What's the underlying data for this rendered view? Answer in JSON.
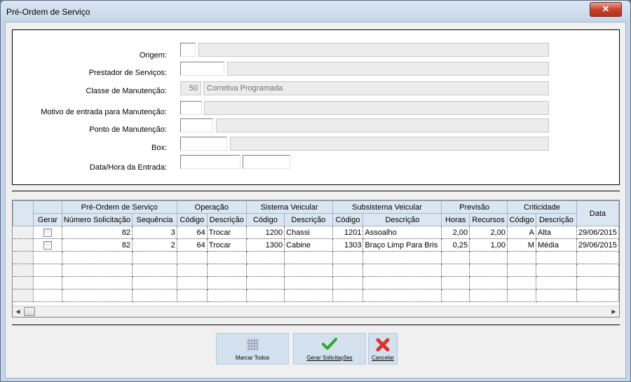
{
  "window": {
    "title": "Pré-Ordem de Serviço",
    "close_glyph": "✕"
  },
  "form": {
    "origem": {
      "label": "Origem:",
      "code": "",
      "desc": ""
    },
    "prestador": {
      "label": "Prestador de Serviços:",
      "code": "",
      "desc": ""
    },
    "classe": {
      "label": "Classe de Manutenção:",
      "code": "50",
      "desc": "Corretiva Programada"
    },
    "motivo": {
      "label": "Motivo de entrada para Manutenção:",
      "code": "",
      "desc": ""
    },
    "ponto": {
      "label": "Ponto de Manutenção:",
      "code": "",
      "desc": ""
    },
    "box": {
      "label": "Box:",
      "code": "",
      "desc": ""
    },
    "data_hora": {
      "label": "Data/Hora da Entrada:",
      "date": "",
      "time": ""
    }
  },
  "grid": {
    "group_headers": [
      "Pré-Ordem de Serviço",
      "Operação",
      "Sistema Veicular",
      "Subsistema Veicular",
      "Previsão",
      "Criticidade"
    ],
    "columns": [
      "Gerar",
      "Número Solicitação",
      "Sequência",
      "Código",
      "Descrição",
      "Código",
      "Descrição",
      "Código",
      "Descrição",
      "Horas",
      "Recursos",
      "Código",
      "Descrição",
      "Data"
    ],
    "rows": [
      {
        "gerar": false,
        "numero": "82",
        "sequencia": "3",
        "op_codigo": "64",
        "op_desc": "Trocar",
        "sis_codigo": "1200",
        "sis_desc": "Chassi",
        "sub_codigo": "1201",
        "sub_desc": "Assoalho",
        "horas": "2,00",
        "recursos": "2,00",
        "crit_codigo": "A",
        "crit_desc": "Alta",
        "data": "29/06/2015"
      },
      {
        "gerar": false,
        "numero": "82",
        "sequencia": "2",
        "op_codigo": "64",
        "op_desc": "Trocar",
        "sis_codigo": "1300",
        "sis_desc": "Cabine",
        "sub_codigo": "1303",
        "sub_desc": "Braço Limp Para Bris",
        "horas": "0,25",
        "recursos": "1,00",
        "crit_codigo": "M",
        "crit_desc": "Média",
        "data": "29/06/2015"
      }
    ],
    "scroll_left_glyph": "◀",
    "scroll_right_glyph": "▶"
  },
  "toolbar": {
    "marcar_todos": {
      "label": "Marcar Todos",
      "icon": "grid-icon"
    },
    "gerar": {
      "label": "Gerar Solicitações",
      "icon": "green-check-icon"
    },
    "cancelar": {
      "label": "Cancelar",
      "icon": "red-x-icon"
    }
  },
  "colors": {
    "title_bg": "#c5d6ea",
    "header_bg": "#dbe6f3",
    "button_bg": "#d3e0ee",
    "check_green": "#2da82d",
    "cancel_red": "#d9342b"
  }
}
